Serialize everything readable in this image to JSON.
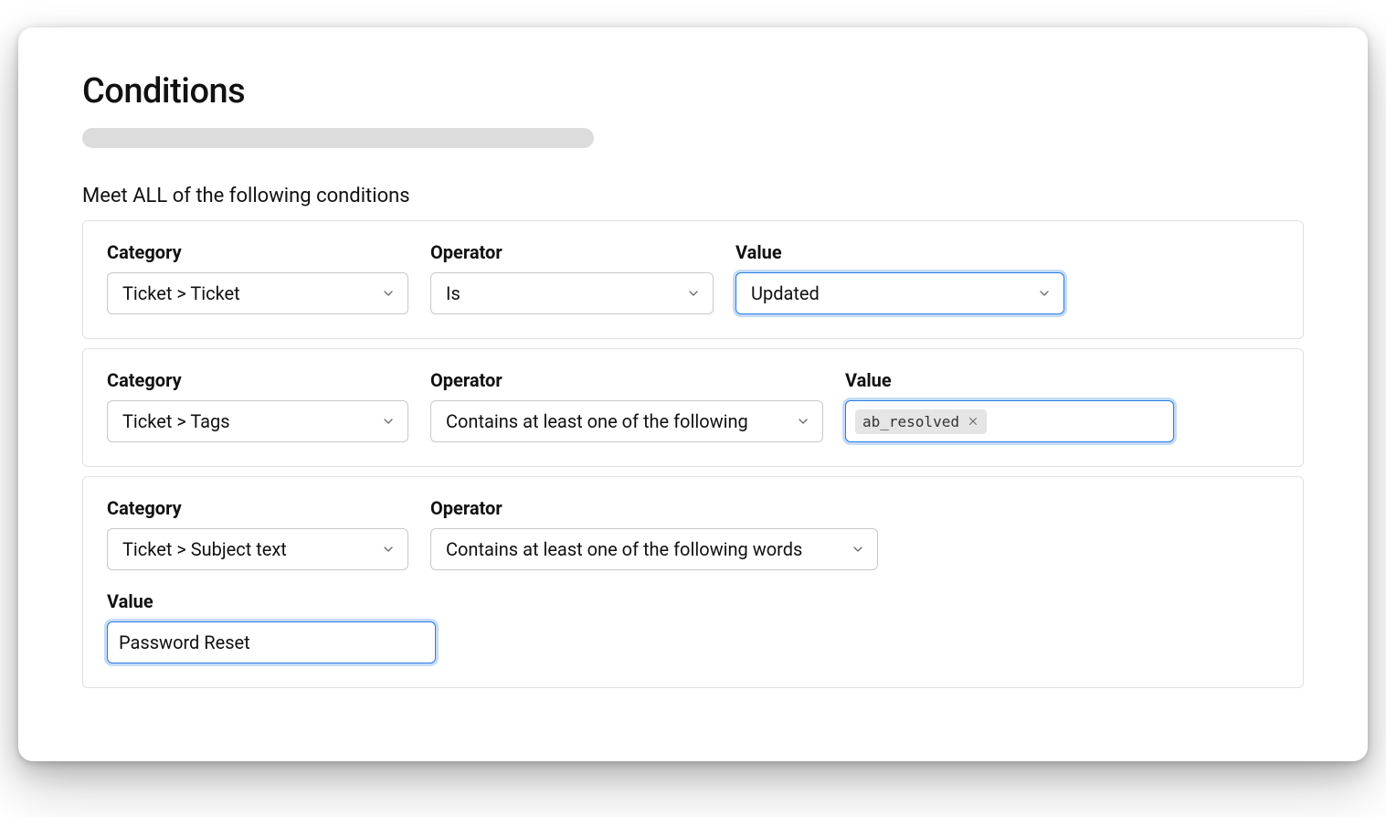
{
  "title": "Conditions",
  "sectionLabel": "Meet ALL of the following conditions",
  "labels": {
    "category": "Category",
    "operator": "Operator",
    "value": "Value"
  },
  "conditions": [
    {
      "category": "Ticket > Ticket",
      "operator": "Is",
      "valueType": "select",
      "value": "Updated",
      "valueFocused": true
    },
    {
      "category": "Ticket > Tags",
      "operator": "Contains at least one of the following",
      "valueType": "tags",
      "tags": [
        "ab_resolved"
      ],
      "valueFocused": true
    },
    {
      "category": "Ticket > Subject text",
      "operator": "Contains at least one of the following words",
      "valueType": "text",
      "value": "Password Reset",
      "valueFocused": true
    }
  ]
}
